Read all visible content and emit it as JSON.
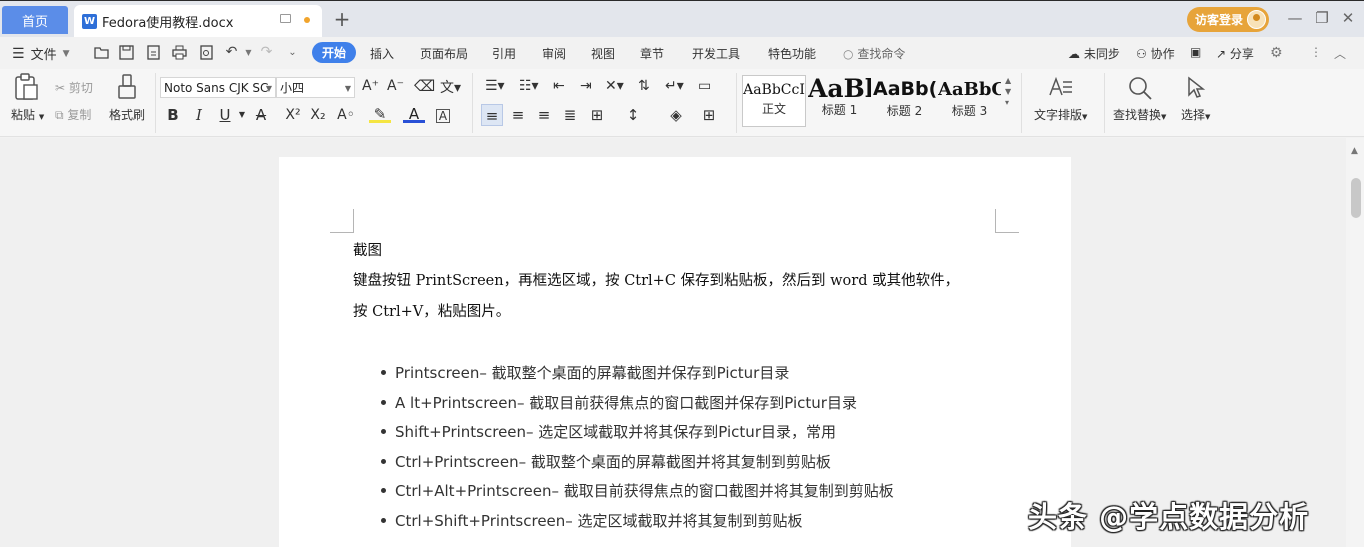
{
  "tabs": {
    "home": "首页",
    "document": "Fedora使用教程.docx",
    "login": "访客登录"
  },
  "menu": {
    "file": "文件",
    "items": [
      "开始",
      "插入",
      "页面布局",
      "引用",
      "审阅",
      "视图",
      "章节",
      "开发工具",
      "特色功能"
    ],
    "command_search": "查找命令",
    "unsynced": "未同步",
    "collaborate": "协作",
    "share": "分享"
  },
  "ribbon": {
    "paste": "粘贴",
    "cut": "剪切",
    "copy": "复制",
    "format_painter": "格式刷",
    "font_name": "Noto Sans CJK SC",
    "font_size": "小四",
    "styles": [
      {
        "sample": "AaBbCcI",
        "label": "正文"
      },
      {
        "sample": "AaBl",
        "label": "标题 1"
      },
      {
        "sample": "AaBb(",
        "label": "标题 2"
      },
      {
        "sample": "AaBbC",
        "label": "标题 3"
      }
    ],
    "text_layout": "文字排版",
    "find_replace": "查找替换",
    "select": "选择"
  },
  "document": {
    "heading": "截图",
    "para1": "键盘按钮 PrintScreen，再框选区域，按 Ctrl+C 保存到粘贴板，然后到 word 或其他软件，",
    "para2": "按 Ctrl+V，粘贴图片。",
    "bullets": [
      "Printscreen– 截取整个桌面的屏幕截图并保存到Pictur目录",
      "A lt+Printscreen– 截取目前获得焦点的窗口截图并保存到Pictur目录",
      "Shift+Printscreen– 选定区域截取并将其保存到Pictur目录，常用",
      "Ctrl+Printscreen– 截取整个桌面的屏幕截图并将其复制到剪贴板",
      "Ctrl+Alt+Printscreen– 截取目前获得焦点的窗口截图并将其复制到剪贴板",
      "Ctrl+Shift+Printscreen– 选定区域截取并将其复制到剪贴板"
    ]
  },
  "watermark": "头条 @学点数据分析",
  "colors": {
    "accent": "#3f80ea",
    "home_tab": "#5b8de8",
    "login": "#e7a43a",
    "unsaved_dot": "#f1a42c"
  }
}
